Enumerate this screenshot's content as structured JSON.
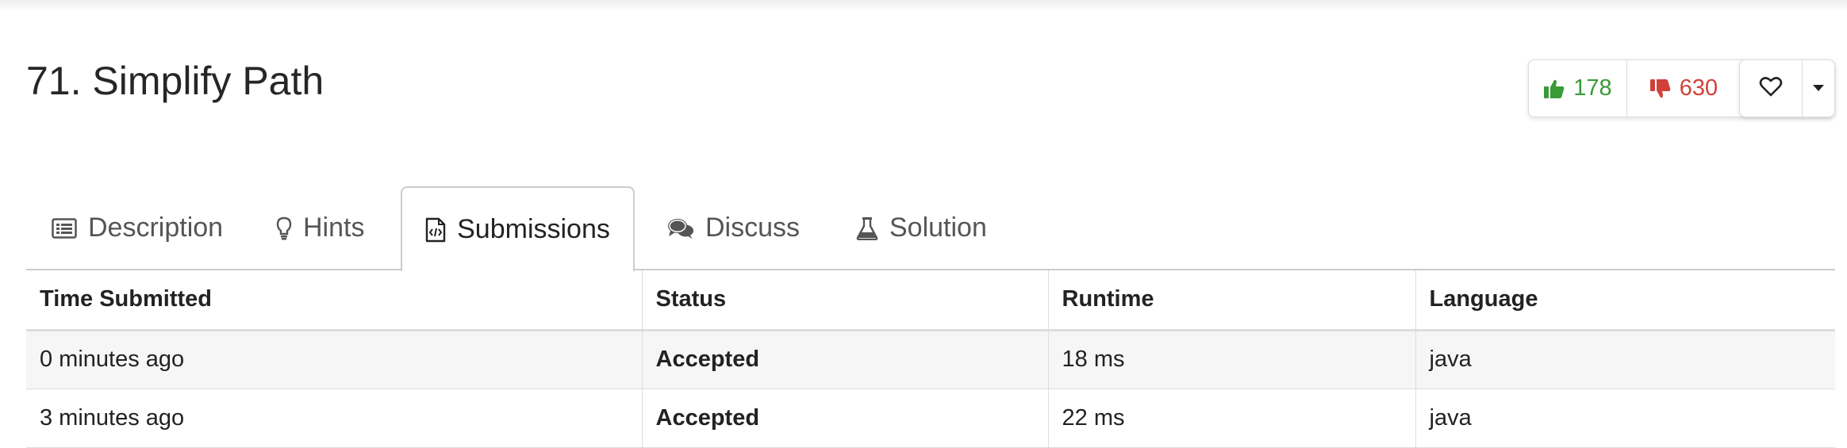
{
  "problem": {
    "title": "71. Simplify Path"
  },
  "votes": {
    "likes": "178",
    "dislikes": "630"
  },
  "colors": {
    "like": "#3a9a38",
    "dislike": "#d0413a",
    "accepted": "#3a9a38"
  },
  "tabs": [
    {
      "label": "Description",
      "icon": "list-icon",
      "active": false
    },
    {
      "label": "Hints",
      "icon": "lightbulb-icon",
      "active": false
    },
    {
      "label": "Submissions",
      "icon": "code-file-icon",
      "active": true
    },
    {
      "label": "Discuss",
      "icon": "comments-icon",
      "active": false
    },
    {
      "label": "Solution",
      "icon": "flask-icon",
      "active": false
    }
  ],
  "table": {
    "headers": [
      "Time Submitted",
      "Status",
      "Runtime",
      "Language"
    ],
    "rows": [
      {
        "time": "0 minutes ago",
        "status": "Accepted",
        "runtime": "18 ms",
        "language": "java"
      },
      {
        "time": "3 minutes ago",
        "status": "Accepted",
        "runtime": "22 ms",
        "language": "java"
      }
    ]
  }
}
